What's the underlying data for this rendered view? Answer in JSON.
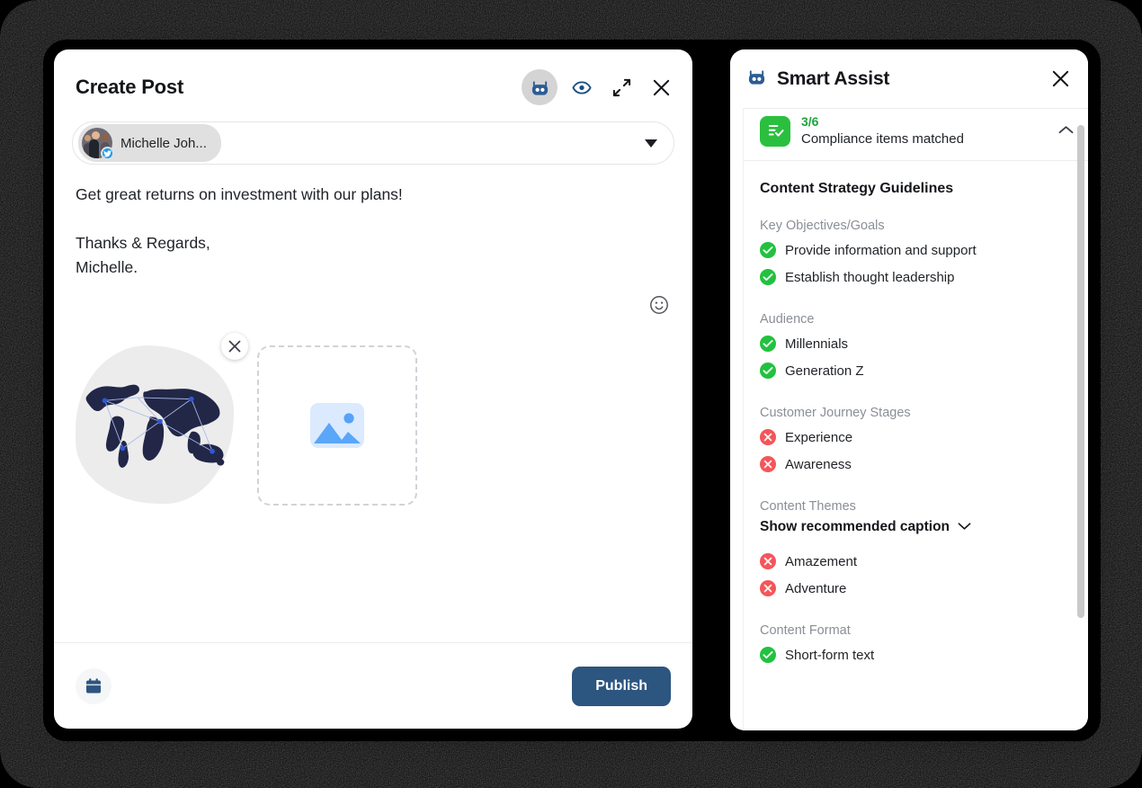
{
  "window_create_post": {
    "title": "Create Post",
    "header_actions": [
      {
        "name": "smart-assist-bot-icon",
        "label": "Smart Assist",
        "active": true
      },
      {
        "name": "preview-eye-icon",
        "label": "Preview"
      },
      {
        "name": "expand-icon",
        "label": "Expand"
      },
      {
        "name": "close-icon",
        "label": "Close"
      }
    ],
    "account_selector": {
      "name": "Michelle Joh...",
      "network": "twitter",
      "dropdown_caret": "▼"
    },
    "composer": {
      "post_text": "Get great returns on investment with our plans!\n\nThanks & Regards,\nMichelle.",
      "emoji_button_label": "Emoji"
    },
    "media": {
      "attached_label": "world-map-image",
      "remove_label": "Remove image",
      "add_media_label": "Add media"
    },
    "footer": {
      "schedule_label": "Schedule",
      "publish_label": "Publish",
      "publish_color": "#2c5580"
    }
  },
  "window_smart_assist": {
    "title": "Smart Assist",
    "close_label": "Close",
    "compliance": {
      "count": "3/6",
      "label": "Compliance items matched",
      "count_color": "#1ea33a",
      "badge_color": "#2bbf3f",
      "collapse_label": "Collapse"
    },
    "guidelines_title": "Content Strategy Guidelines",
    "show_caption_label": "Show recommended caption",
    "status_colors": {
      "ok": "#22c13f",
      "no": "#f4555a"
    },
    "sections": [
      {
        "heading": "Key Objectives/Goals",
        "items": [
          {
            "label": "Provide information and support",
            "status": "ok"
          },
          {
            "label": "Establish thought leadership",
            "status": "ok"
          }
        ]
      },
      {
        "heading": "Audience",
        "items": [
          {
            "label": "Millennials",
            "status": "ok"
          },
          {
            "label": "Generation Z",
            "status": "ok"
          }
        ]
      },
      {
        "heading": "Customer Journey Stages",
        "items": [
          {
            "label": "Experience",
            "status": "no"
          },
          {
            "label": "Awareness",
            "status": "no"
          }
        ]
      },
      {
        "heading": "Content Themes",
        "has_caption_toggle": true,
        "items": [
          {
            "label": "Amazement",
            "status": "no"
          },
          {
            "label": "Adventure",
            "status": "no"
          }
        ]
      },
      {
        "heading": "Content Format",
        "items": [
          {
            "label": "Short-form text",
            "status": "ok"
          }
        ]
      }
    ]
  }
}
